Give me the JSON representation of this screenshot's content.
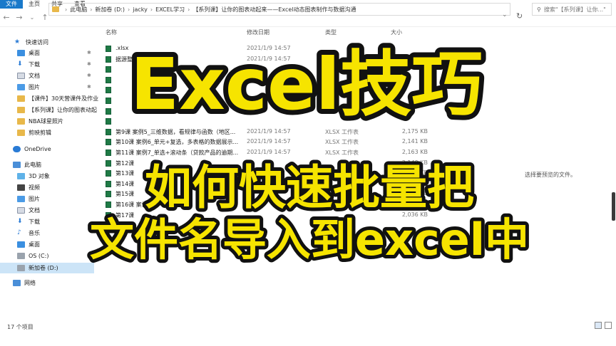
{
  "ribbon": {
    "tabs": [
      "文件",
      "主页",
      "共享",
      "查看"
    ]
  },
  "address": {
    "crumbs": [
      "此电脑",
      "新加卷 (D:)",
      "jacky",
      "EXCEL学习",
      "【系列课】让你的图表动起来——Excel动态图表制作与数据沟通"
    ],
    "search_placeholder": "搜索\"【系列课】让你...\""
  },
  "nav": {
    "quick_access": "快速访问",
    "items": [
      {
        "label": "桌面",
        "pinned": true
      },
      {
        "label": "下载",
        "pinned": true
      },
      {
        "label": "文档",
        "pinned": true
      },
      {
        "label": "图片",
        "pinned": true
      },
      {
        "label": "【课件】30天营课件及作业"
      },
      {
        "label": "【系列课】让你的图表动起"
      },
      {
        "label": "NBA球星照片"
      },
      {
        "label": "剪映剪辑"
      }
    ],
    "onedrive": "OneDrive",
    "this_pc": "此电脑",
    "pc_items": [
      "3D 对象",
      "视频",
      "图片",
      "文档",
      "下载",
      "音乐",
      "桌面",
      "OS (C:)",
      "新加卷 (D:)"
    ],
    "network": "网络"
  },
  "columns": {
    "name": "名称",
    "date": "修改日期",
    "type": "类型",
    "size": "大小"
  },
  "files": [
    {
      "name": ".xlsx",
      "date": "2021/1/9 14:57",
      "type": "",
      "size": ""
    },
    {
      "name": "据源整理.xlsx",
      "date": "2021/1/9 14:57",
      "type": "",
      "size": ""
    },
    {
      "name": "",
      "date": "",
      "type": "",
      "size": ""
    },
    {
      "name": "",
      "date": "",
      "type": "",
      "size": ""
    },
    {
      "name": "",
      "date": "",
      "type": "",
      "size": ""
    },
    {
      "name": "",
      "date": "",
      "type": "",
      "size": ""
    },
    {
      "name": "",
      "date": "",
      "type": "",
      "size": ""
    },
    {
      "name": "",
      "date": "",
      "type": "",
      "size": ""
    },
    {
      "name": "第9课 案例5_三维数据，看规律与函数（地区...",
      "date": "2021/1/9 14:57",
      "type": "XLSX 工作表",
      "size": "2,175 KB"
    },
    {
      "name": "第10课 案例6_单元+复选，多表格的数据展示...",
      "date": "2021/1/9 14:57",
      "type": "XLSX 工作表",
      "size": "2,141 KB"
    },
    {
      "name": "第11课 案例7_单选+滚动条（贷款产品的逾期...",
      "date": "2021/1/9 14:57",
      "type": "XLSX 工作表",
      "size": "2,163 KB"
    },
    {
      "name": "第12课",
      "date": "",
      "type": "",
      "size": "2,149 KB"
    },
    {
      "name": "第13课",
      "date": "",
      "type": "",
      "size": "2,166 KB"
    },
    {
      "name": "第14课",
      "date": "",
      "type": "",
      "size": "2,151 KB"
    },
    {
      "name": "第15课",
      "date": "",
      "type": "",
      "size": "2,158 KB"
    },
    {
      "name": "第16课 案例",
      "date": "",
      "type": "",
      "size": "2,146 KB"
    },
    {
      "name": "第17课",
      "date": "",
      "type": "",
      "size": "2,036 KB"
    }
  ],
  "preview_text": "选择要预览的文件。",
  "status": "17 个项目",
  "overlay": {
    "title": "Excel技巧",
    "line1": "如何快速批量把",
    "line2": "文件名导入到excel中"
  },
  "colors": {
    "title_fill": "#f6e400",
    "accent_blue": "#1979ca",
    "xlsx_green": "#1f7a45"
  }
}
